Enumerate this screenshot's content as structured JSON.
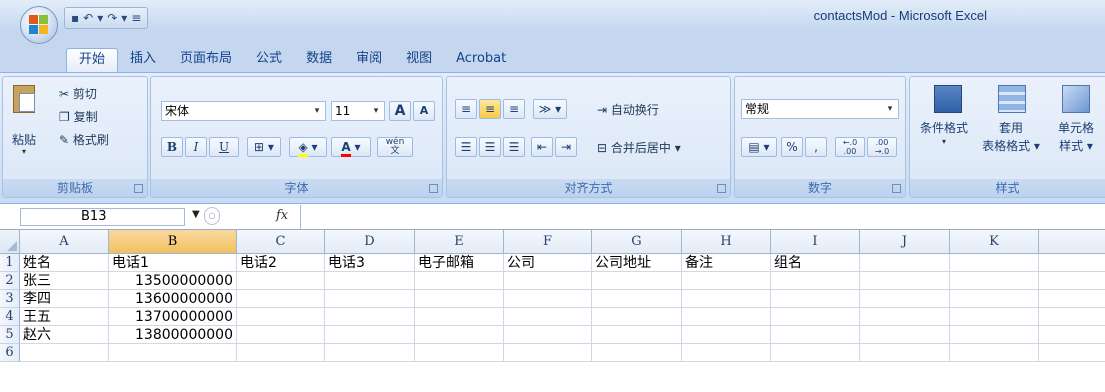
{
  "window": {
    "title": "contactsMod - Microsoft Excel",
    "qat": [
      "▪",
      "↶",
      "▾",
      "↷",
      "▾",
      "≡"
    ]
  },
  "tabs": [
    {
      "label": "开始",
      "active": true
    },
    {
      "label": "插入"
    },
    {
      "label": "页面布局"
    },
    {
      "label": "公式"
    },
    {
      "label": "数据"
    },
    {
      "label": "审阅"
    },
    {
      "label": "视图"
    },
    {
      "label": "Acrobat"
    }
  ],
  "ribbon": {
    "clipboard": {
      "label": "剪贴板",
      "paste": "粘贴",
      "cut": "剪切",
      "copy": "复制",
      "format_painter": "格式刷"
    },
    "font": {
      "label": "字体",
      "name": "宋体",
      "size": "11",
      "grow": "A",
      "shrink": "A",
      "bold": "B",
      "italic": "I",
      "underline": "U",
      "wen": "wén\n文"
    },
    "alignment": {
      "label": "对齐方式",
      "wrap": "自动换行",
      "merge": "合并后居中"
    },
    "number": {
      "label": "数字",
      "format": "常规",
      "percent": "%",
      "comma": ",",
      "inc_dec": "←.0 .00",
      "dec_dec": ".00 →.0"
    },
    "styles": {
      "label": "样式",
      "conditional": "条件格式",
      "table_1": "套用",
      "table_2": "表格格式",
      "cell_1": "单元格",
      "cell_2": "样式"
    }
  },
  "formula_bar": {
    "name_box": "B13",
    "fx": "fx",
    "content": ""
  },
  "sheet": {
    "columns": [
      "A",
      "B",
      "C",
      "D",
      "E",
      "F",
      "G",
      "H",
      "I",
      "J",
      "K"
    ],
    "selected_column": "B",
    "rows": [
      {
        "num": "1",
        "cells": [
          "姓名",
          "电话1",
          "电话2",
          "电话3",
          "电子邮箱",
          "公司",
          "公司地址",
          "备注",
          "组名",
          "",
          ""
        ]
      },
      {
        "num": "2",
        "cells": [
          "张三",
          "13500000000",
          "",
          "",
          "",
          "",
          "",
          "",
          "",
          "",
          ""
        ]
      },
      {
        "num": "3",
        "cells": [
          "李四",
          "13600000000",
          "",
          "",
          "",
          "",
          "",
          "",
          "",
          "",
          ""
        ]
      },
      {
        "num": "4",
        "cells": [
          "王五",
          "13700000000",
          "",
          "",
          "",
          "",
          "",
          "",
          "",
          "",
          ""
        ]
      },
      {
        "num": "5",
        "cells": [
          "赵六",
          "13800000000",
          "",
          "",
          "",
          "",
          "",
          "",
          "",
          "",
          ""
        ]
      },
      {
        "num": "6",
        "cells": [
          "",
          "",
          "",
          "",
          "",
          "",
          "",
          "",
          "",
          "",
          ""
        ]
      }
    ]
  },
  "colors": {
    "ribbon_bg": "#dbe7f7",
    "selected_header": "#f1c15f",
    "title_text": "#153d77"
  }
}
